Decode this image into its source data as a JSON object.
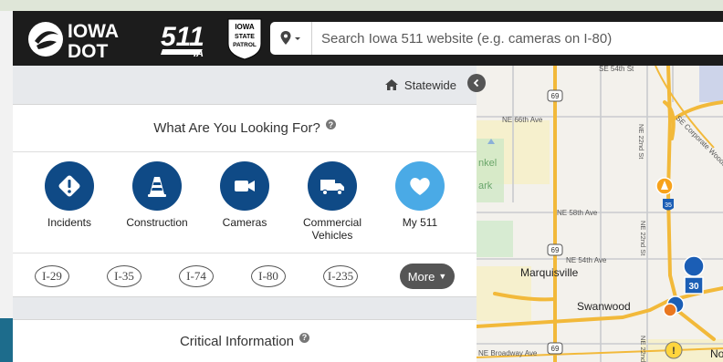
{
  "header": {
    "brand_logo_text": "IOWA DOT",
    "logo_511_text": "511 IA",
    "patrol_badge": "IOWA STATE PATROL"
  },
  "search": {
    "placeholder": "Search Iowa 511 website (e.g. cameras on I-80)"
  },
  "panel": {
    "location_label": "Statewide",
    "section_title": "What Are You Looking For?",
    "categories": [
      {
        "label": "Incidents",
        "icon": "warning-diamond-icon"
      },
      {
        "label": "Construction",
        "icon": "traffic-cone-icon"
      },
      {
        "label": "Cameras",
        "icon": "video-camera-icon"
      },
      {
        "label": "Commercial Vehicles",
        "icon": "truck-icon"
      },
      {
        "label": "My 511",
        "icon": "heart-icon"
      }
    ],
    "routes": [
      "I-29",
      "I-35",
      "I-74",
      "I-80",
      "I-235"
    ],
    "more_label": "More",
    "critical_title": "Critical Information"
  },
  "map": {
    "labels": {
      "se54": "SE 54th St",
      "ne66": "NE 66th Ave",
      "secorp": "SE Corporate Woods",
      "ne22a": "NE 22nd St",
      "ne58": "NE 58th Ave",
      "ne22b": "NE 22nd St",
      "ne54": "NE 54th Ave",
      "marquisville": "Marquisville",
      "swanwood": "Swanwood",
      "nebroadway": "NE Broadway Ave",
      "ne22c": "NE 22nd St",
      "nk": "No",
      "rankel": "nkel",
      "park": "ark",
      "hwy69": "69",
      "i35": "35",
      "i30": "30"
    }
  },
  "colors": {
    "brand_blue": "#0f4a86",
    "accent_light_blue": "#4aaae6",
    "header_bg": "#1c1c1c",
    "map_highway": "#f5c04a"
  }
}
